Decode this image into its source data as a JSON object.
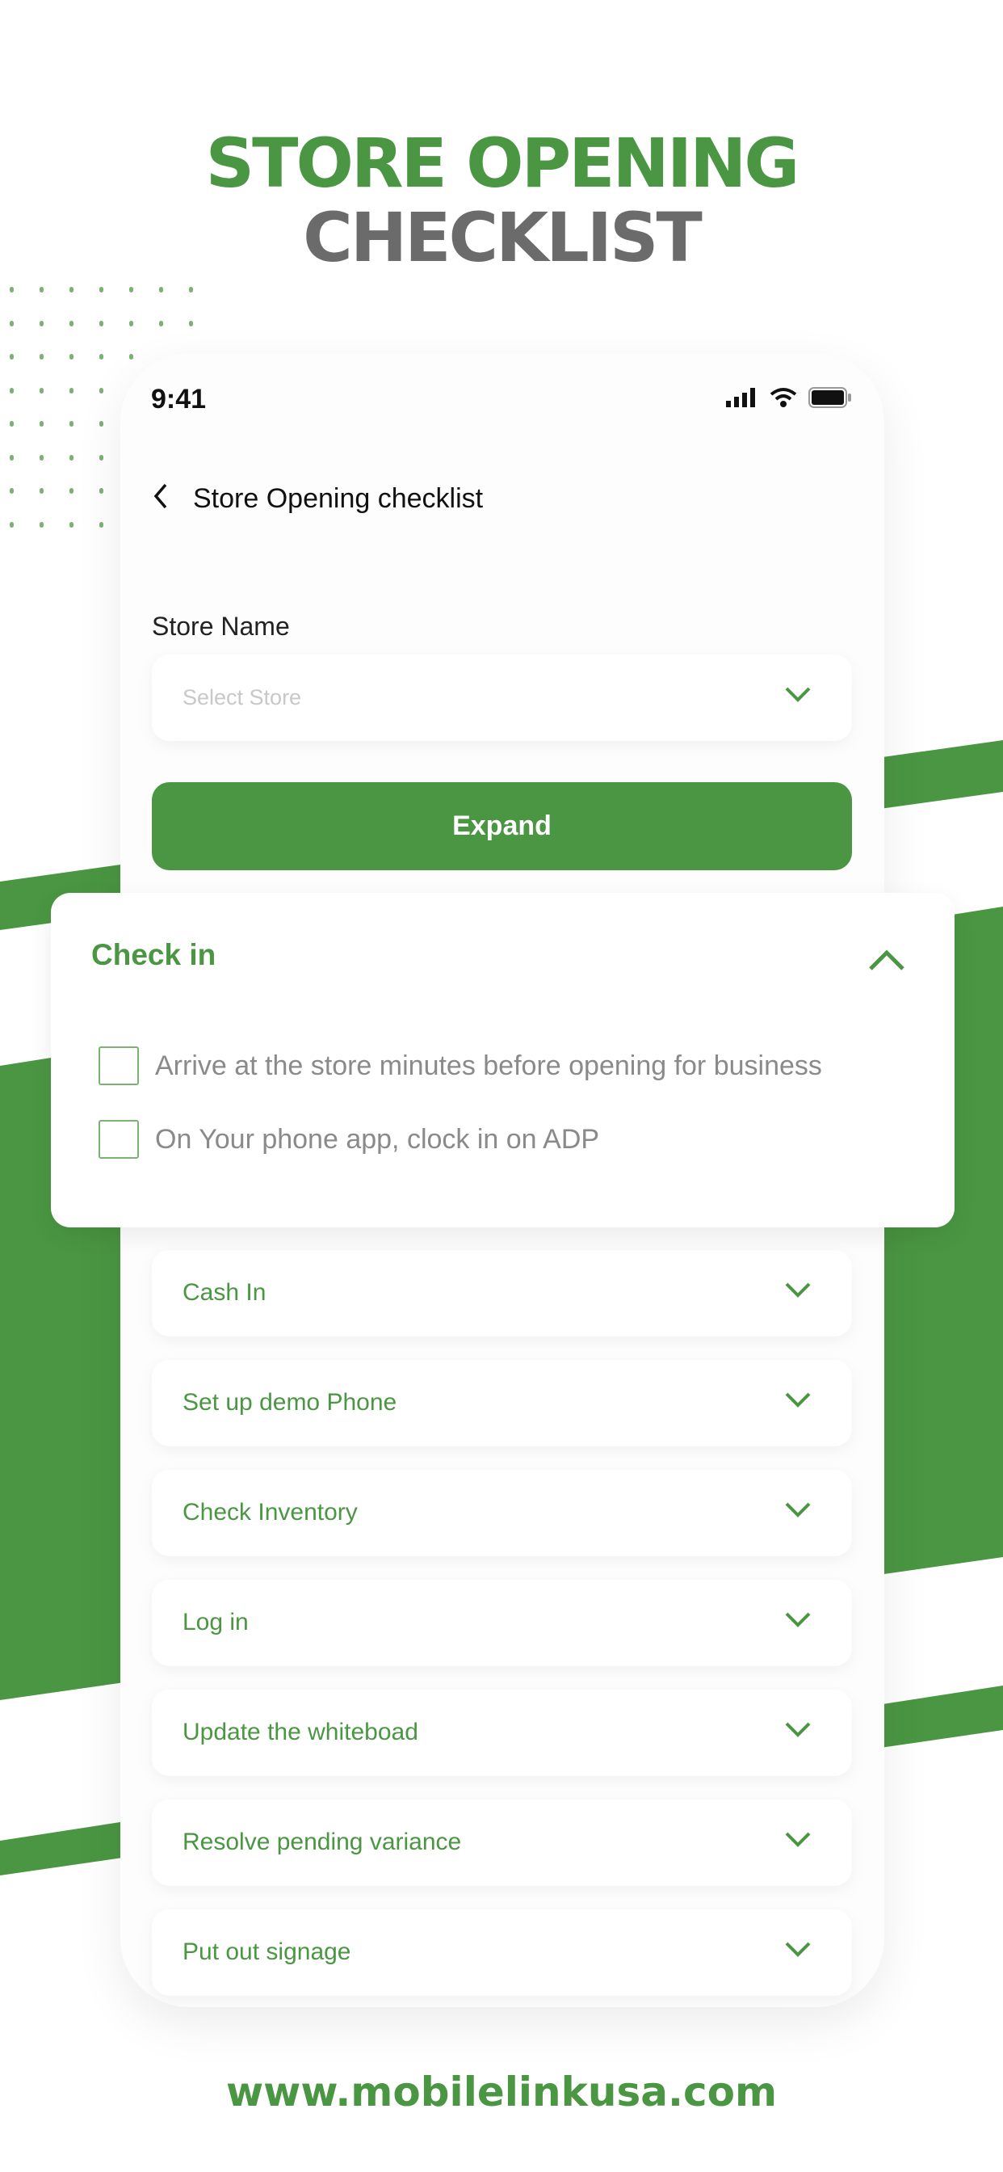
{
  "headline": {
    "line1": "STORE OPENING",
    "line2": "CHECKLIST"
  },
  "colors": {
    "brand_green": "#4a9642",
    "title_gray": "#6b6b6b"
  },
  "status_bar": {
    "time": "9:41",
    "icons": [
      "signal-icon",
      "wifi-icon",
      "battery-icon"
    ]
  },
  "nav": {
    "back_icon": "chevron-left-icon",
    "title": "Store Opening checklist"
  },
  "store": {
    "label": "Store Name",
    "placeholder": "Select Store"
  },
  "expand_label": "Expand",
  "check_in": {
    "title": "Check in",
    "expanded": true,
    "items": [
      {
        "label": "Arrive at the store minutes before opening for business",
        "checked": false
      },
      {
        "label": "On Your phone app, clock in on ADP",
        "checked": false
      }
    ]
  },
  "sections": [
    {
      "label": "Cash In"
    },
    {
      "label": "Set up demo Phone"
    },
    {
      "label": "Check Inventory"
    },
    {
      "label": "Log in"
    },
    {
      "label": "Update the whiteboad"
    },
    {
      "label": "Resolve pending variance"
    },
    {
      "label": "Put out signage"
    }
  ],
  "footer_url": "www.mobilelinkusa.com"
}
